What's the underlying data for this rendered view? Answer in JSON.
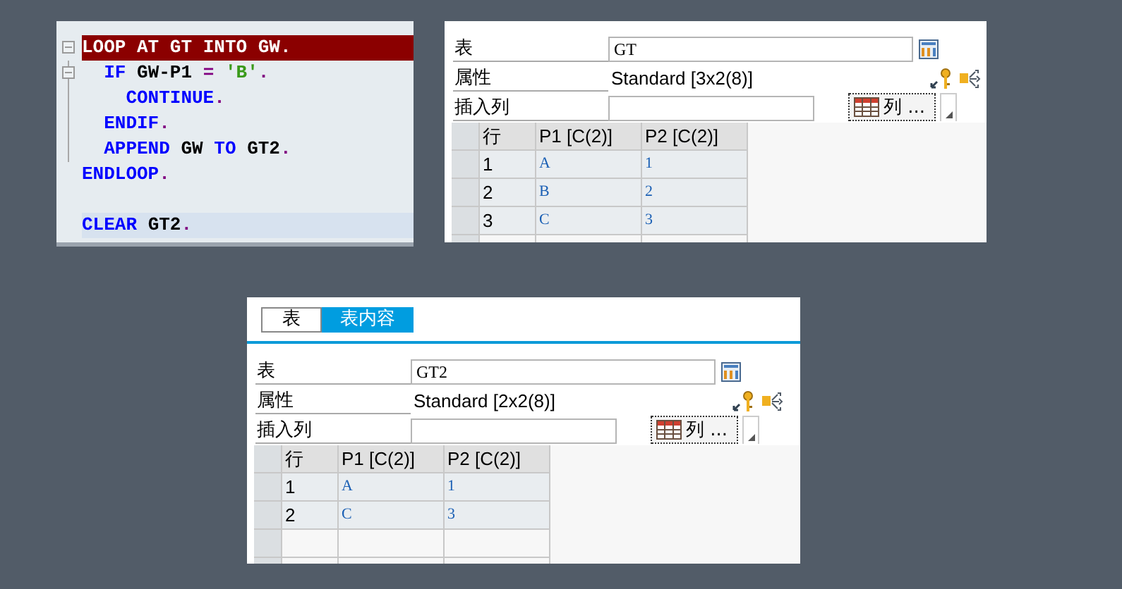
{
  "code": {
    "lines": [
      {
        "executing": true,
        "selected": false,
        "fold": true,
        "tokens": [
          {
            "kind": "keyword",
            "text": "LOOP AT"
          },
          {
            "kind": "name",
            "text": "GT"
          },
          {
            "kind": "keyword",
            "text": "INTO"
          },
          {
            "kind": "name",
            "text": "GW"
          },
          {
            "kind": "period",
            "text": "."
          }
        ],
        "children": [
          {
            "executing": false,
            "selected": false,
            "fold": true,
            "tokens": [
              {
                "kind": "keyword",
                "text": "IF"
              },
              {
                "kind": "name",
                "text": "GW-P1"
              },
              {
                "kind": "operator",
                "text": "="
              },
              {
                "kind": "string",
                "text": "'B'"
              },
              {
                "kind": "period",
                "text": "."
              }
            ],
            "children": [
              {
                "executing": false,
                "selected": false,
                "fold": false,
                "tokens": [
                  {
                    "kind": "keyword",
                    "text": "CONTINUE"
                  },
                  {
                    "kind": "period",
                    "text": "."
                  }
                ]
              }
            ]
          },
          {
            "executing": false,
            "selected": false,
            "fold": false,
            "tokens": [
              {
                "kind": "keyword",
                "text": "ENDIF"
              },
              {
                "kind": "period",
                "text": "."
              }
            ]
          },
          {
            "executing": false,
            "selected": false,
            "fold": false,
            "tokens": [
              {
                "kind": "keyword",
                "text": "APPEND"
              },
              {
                "kind": "name",
                "text": "GW"
              },
              {
                "kind": "keyword",
                "text": "TO"
              },
              {
                "kind": "name",
                "text": "GT2"
              },
              {
                "kind": "period",
                "text": "."
              }
            ]
          }
        ]
      },
      {
        "executing": false,
        "selected": false,
        "fold": false,
        "tokens": [
          {
            "kind": "keyword",
            "text": "ENDLOOP"
          },
          {
            "kind": "period",
            "text": "."
          }
        ]
      },
      {
        "executing": false,
        "selected": false,
        "fold": false
      },
      {
        "executing": false,
        "selected": true,
        "fold": false,
        "tokens": [
          {
            "kind": "keyword",
            "text": "CLEAR"
          },
          {
            "kind": "name",
            "text": "GT2"
          },
          {
            "kind": "period",
            "text": "."
          }
        ]
      }
    ]
  },
  "inspectors": [
    {
      "table_label": "表",
      "table_name": "GT",
      "attributes_label": "属性",
      "attributes": "Standard [3x2(8)]",
      "insert_label": "插入列",
      "columns_button": "列 ...",
      "grid": {
        "columns": [
          "行",
          "P1 [C(2)]",
          "P2 [C(2)]"
        ],
        "rows": [
          [
            "1",
            "A",
            "1"
          ],
          [
            "2",
            "B",
            "2"
          ],
          [
            "3",
            "C",
            "3"
          ]
        ]
      }
    },
    {
      "tabs": [
        {
          "label": "表",
          "selected": false
        },
        {
          "label": "表内容",
          "selected": true
        }
      ],
      "table_label": "表",
      "table_name": "GT2",
      "attributes_label": "属性",
      "attributes": "Standard [2x2(8)]",
      "insert_label": "插入列",
      "columns_button": "列 ...",
      "grid": {
        "columns": [
          "行",
          "P1 [C(2)]",
          "P2 [C(2)]"
        ],
        "rows": [
          [
            "1",
            "A",
            "1"
          ],
          [
            "2",
            "C",
            "3"
          ]
        ]
      }
    }
  ]
}
